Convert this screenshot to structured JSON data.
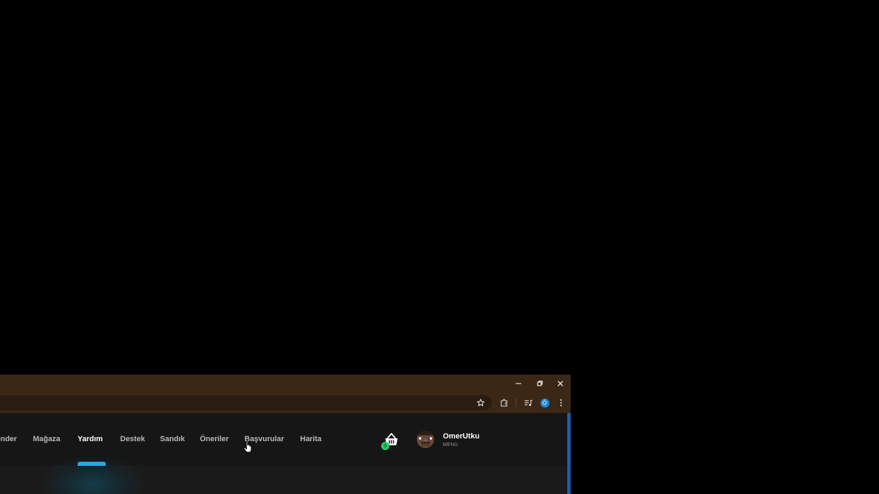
{
  "window": {
    "minimize_icon": "minimize-icon",
    "maximize_icon": "restore-icon",
    "close_icon": "close-icon"
  },
  "toolbar": {
    "icons": [
      "star-icon",
      "extensions-icon",
      "media-icon",
      "profile-icon",
      "kebab-menu-icon"
    ],
    "profile_initial": "Ö"
  },
  "nav": {
    "items": [
      {
        "label": "önder"
      },
      {
        "label": "Mağaza"
      },
      {
        "label": "Yardım"
      },
      {
        "label": "Destek"
      },
      {
        "label": "Sandık"
      },
      {
        "label": "Öneriler"
      },
      {
        "label": "Başvurular"
      },
      {
        "label": "Harita"
      }
    ],
    "active_label": "Yardım"
  },
  "cart": {
    "count": "0",
    "icon": "basket-icon"
  },
  "user": {
    "name": "OmerUtku",
    "menu_label": "MENU"
  },
  "colors": {
    "titlebar": "#3a2716",
    "accent": "#29a6e8",
    "cart_badge": "#27c763",
    "profile_badge": "#1e88d6"
  }
}
